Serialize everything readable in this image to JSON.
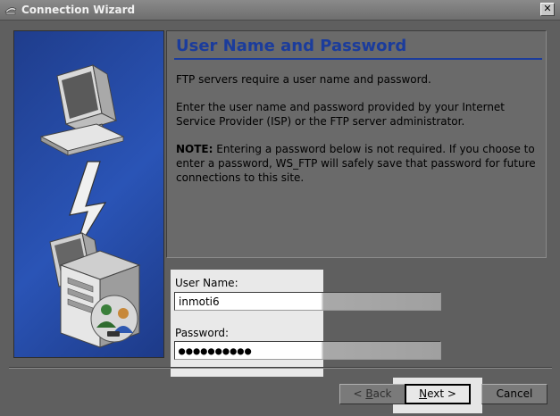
{
  "window": {
    "title": "Connection Wizard",
    "close_glyph": "✕"
  },
  "page": {
    "heading": "User Name and Password",
    "paragraph1": "FTP servers require a user name and password.",
    "paragraph2": "Enter the user name and password provided by your Internet Service Provider (ISP) or the FTP server administrator.",
    "note_label": "NOTE:",
    "note_text": " Entering a password below is not required. If you choose to enter a password, WS_FTP will safely save that password for future connections to this site."
  },
  "form": {
    "username_label": "User Name:",
    "username_value": "inmoti6",
    "password_label": "Password:",
    "password_value": "●●●●●●●●●●"
  },
  "buttons": {
    "back_prefix": "< ",
    "back_accel": "B",
    "back_rest": "ack",
    "next_accel": "N",
    "next_rest": "ext >",
    "cancel": "Cancel"
  },
  "icons": {
    "window_icon": "ftp-app-icon",
    "illustration": "network-computers-illustration"
  }
}
